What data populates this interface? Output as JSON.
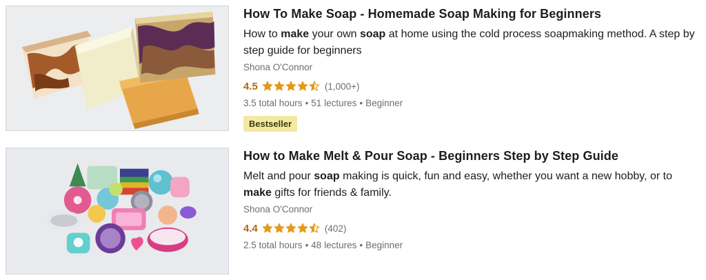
{
  "courses": [
    {
      "title": "How To Make Soap - Homemade Soap Making for Beginners",
      "description": [
        {
          "text": "How to ",
          "bold": false
        },
        {
          "text": "make",
          "bold": true
        },
        {
          "text": " your own ",
          "bold": false
        },
        {
          "text": "soap",
          "bold": true
        },
        {
          "text": " at home using the cold process soapmaking method. A step by step guide for beginners",
          "bold": false
        }
      ],
      "author": "Shona O'Connor",
      "rating": "4.5",
      "rating_stars": 4.5,
      "rating_count": "(1,000+)",
      "hours": "3.5 total hours",
      "lectures": "51 lectures",
      "level": "Beginner",
      "badge": "Bestseller",
      "thumbnail_icon": "soap-bars-image"
    },
    {
      "title": "How to Make Melt & Pour Soap - Beginners Step by Step Guide",
      "description": [
        {
          "text": "Melt and pour ",
          "bold": false
        },
        {
          "text": "soap",
          "bold": true
        },
        {
          "text": " making is quick, fun and easy, whether you want a new hobby, or to ",
          "bold": false
        },
        {
          "text": "make",
          "bold": true
        },
        {
          "text": " gifts for friends & family.",
          "bold": false
        }
      ],
      "author": "Shona O'Connor",
      "rating": "4.4",
      "rating_stars": 4.4,
      "rating_count": "(402)",
      "hours": "2.5 total hours",
      "lectures": "48 lectures",
      "level": "Beginner",
      "thumbnail_icon": "melt-pour-soaps-image"
    }
  ],
  "meta_separator": "•",
  "colors": {
    "rating": "#b4690e",
    "star": "#e59819",
    "muted_text": "#6a6f73",
    "badge_bg": "#f4e9a3",
    "badge_text": "#3d3c0a"
  }
}
